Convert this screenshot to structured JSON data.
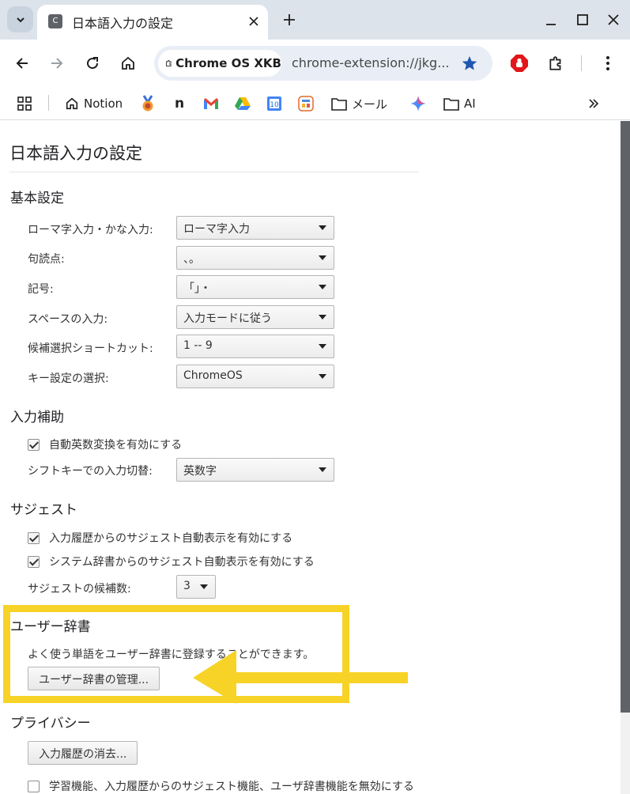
{
  "tab": {
    "favicon_letter": "C",
    "title": "日本語入力の設定"
  },
  "toolbar": {
    "chip_label": "Chrome OS XKB",
    "url": "chrome-extension://jkg..."
  },
  "bookmarks": [
    {
      "label": "Notion",
      "icon": "home-icon"
    },
    {
      "label": "",
      "icon": "medal-icon"
    },
    {
      "label": "",
      "icon": "notion-n-icon"
    },
    {
      "label": "",
      "icon": "gmail-icon"
    },
    {
      "label": "",
      "icon": "drive-icon"
    },
    {
      "label": "",
      "icon": "calendar-icon"
    },
    {
      "label": "",
      "icon": "app-icon"
    },
    {
      "label": "メール",
      "icon": "folder-icon"
    },
    {
      "label": "",
      "icon": "gemini-icon"
    },
    {
      "label": "AI",
      "icon": "folder-icon"
    }
  ],
  "colors": {
    "accent": "#1a73e8",
    "highlight": "#f7d328",
    "star": "#1f57b0",
    "adblock": "#e2161b"
  },
  "page": {
    "title": "日本語入力の設定",
    "basic": {
      "heading": "基本設定",
      "rows": [
        {
          "label": "ローマ字入力・かな入力:",
          "value": "ローマ字入力"
        },
        {
          "label": "句読点:",
          "value": "、。"
        },
        {
          "label": "記号:",
          "value": "「」・"
        },
        {
          "label": "スペースの入力:",
          "value": "入力モードに従う"
        },
        {
          "label": "候補選択ショートカット:",
          "value": "1 -- 9"
        },
        {
          "label": "キー設定の選択:",
          "value": "ChromeOS"
        }
      ]
    },
    "assist": {
      "heading": "入力補助",
      "checkbox": {
        "label": "自動英数変換を有効にする",
        "checked": true
      },
      "shift_label": "シフトキーでの入力切替:",
      "shift_value": "英数字"
    },
    "suggest": {
      "heading": "サジェスト",
      "history": {
        "label": "入力履歴からのサジェスト自動表示を有効にする",
        "checked": true
      },
      "system": {
        "label": "システム辞書からのサジェスト自動表示を有効にする",
        "checked": true
      },
      "count_label": "サジェストの候補数:",
      "count_value": "3"
    },
    "userdict": {
      "heading": "ユーザー辞書",
      "description": "よく使う単語をユーザー辞書に登録することができます。",
      "button": "ユーザー辞書の管理..."
    },
    "privacy": {
      "heading": "プライバシー",
      "button": "入力履歴の消去...",
      "checkbox": {
        "label": "学習機能、入力履歴からのサジェスト機能、ユーザ辞書機能を無効にする",
        "checked": false
      }
    }
  }
}
